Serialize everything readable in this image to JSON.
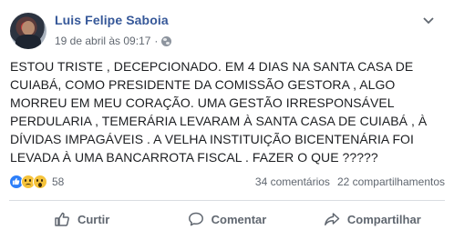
{
  "post": {
    "author": "Luis Felipe Saboia",
    "timestamp": "19 de abril às 09:17",
    "audience_icon": "globe-icon",
    "menu_icon": "chevron-down-icon",
    "text_lines": [
      "ESTOU TRISTE , DECEPCIONADO. EM 4 DIAS NA SANTA CASA DE",
      "CUIABÁ, COMO PRESIDENTE DA COMISSÃO GESTORA , ALGO",
      "MORREU EM MEU CORAÇÃO. UMA GESTÃO IRRESPONSÁVEL",
      "PERDULARIA , TEMERÁRIA LEVARAM À SANTA CASA DE CUIABÁ , À",
      "DÍVIDAS IMPAGÁVEIS . A VELHA INSTITUIÇÃO BICENTENÁRIA FOI",
      "LEVADA À UMA BANCARROTA FISCAL . FAZER O QUE ?????"
    ]
  },
  "stats": {
    "reactions": [
      "like",
      "sad",
      "wow"
    ],
    "reactions_count": "58",
    "comments": "34 comentários",
    "shares": "22 compartilhamentos"
  },
  "actions": {
    "like": "Curtir",
    "comment": "Comentar",
    "share": "Compartilhar"
  },
  "colors": {
    "author": "#365899",
    "secondary_text": "#606770",
    "like_blue": "#2d7ff9",
    "emoji_yellow": "#f5c33b"
  }
}
